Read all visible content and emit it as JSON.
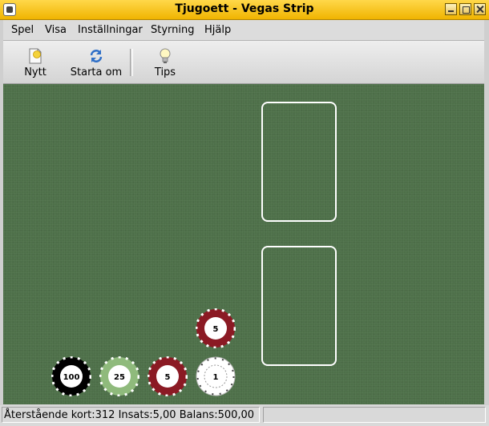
{
  "window": {
    "title": "Tjugoett - Vegas Strip",
    "accent": "#f6c516"
  },
  "menubar": {
    "items": [
      {
        "label": "Spel"
      },
      {
        "label": "Visa"
      },
      {
        "label": "Inställningar"
      },
      {
        "label": "Styrning"
      },
      {
        "label": "Hjälp"
      }
    ]
  },
  "toolbar": {
    "new": {
      "label": "Nytt",
      "icon": "new-game-icon"
    },
    "restart": {
      "label": "Starta om",
      "icon": "restart-icon"
    },
    "tips": {
      "label": "Tips",
      "icon": "lightbulb-icon"
    }
  },
  "table": {
    "felt_color": "#4e7049",
    "chips": [
      {
        "value": "100",
        "color": "#000000"
      },
      {
        "value": "25",
        "color": "#8fba7c"
      },
      {
        "value": "5",
        "color": "#8b1a24"
      },
      {
        "value": "1",
        "color": "#ffffff"
      },
      {
        "value": "5",
        "color": "#8b1a24"
      }
    ]
  },
  "statusbar": {
    "text": "Återstående kort:312  Insats:5,00  Balans:500,00"
  }
}
